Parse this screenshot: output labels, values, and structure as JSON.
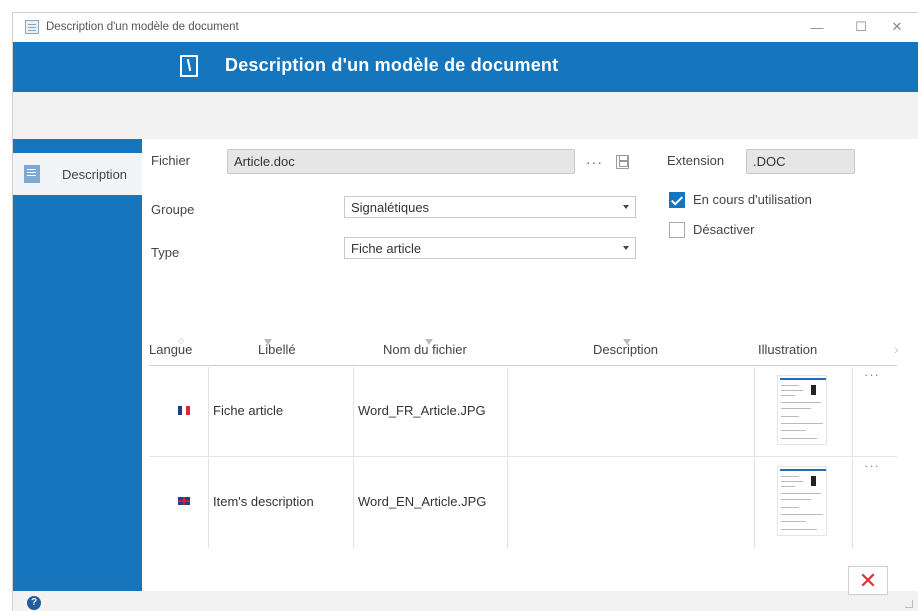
{
  "window": {
    "title": "Description d'un modèle de document"
  },
  "banner": {
    "title": "Description d'un modèle de document"
  },
  "sidebar": {
    "items": [
      {
        "label": "Description",
        "icon": "document-edit-icon"
      }
    ]
  },
  "form": {
    "fichier": {
      "label": "Fichier",
      "value": "Article.doc"
    },
    "extension": {
      "label": "Extension",
      "value": ".DOC"
    },
    "groupe": {
      "label": "Groupe",
      "value": "Signalétiques"
    },
    "type": {
      "label": "Type",
      "value": "Fiche article"
    },
    "en_cours": {
      "label": "En cours d'utilisation",
      "checked": true
    },
    "desactiver": {
      "label": "Désactiver",
      "checked": false
    }
  },
  "table": {
    "columns": [
      "Langue",
      "Libellé",
      "Nom du fichier",
      "Description",
      "Illustration"
    ],
    "rows": [
      {
        "flag": "flag-fr-icon",
        "libelle": "Fiche article",
        "nom_fichier": "Word_FR_Article.JPG",
        "description": ""
      },
      {
        "flag": "flag-uk-icon",
        "libelle": "Item's description",
        "nom_fichier": "Word_EN_Article.JPG",
        "description": ""
      }
    ]
  },
  "colors": {
    "accent": "#1575bd",
    "close": "#e03030"
  }
}
